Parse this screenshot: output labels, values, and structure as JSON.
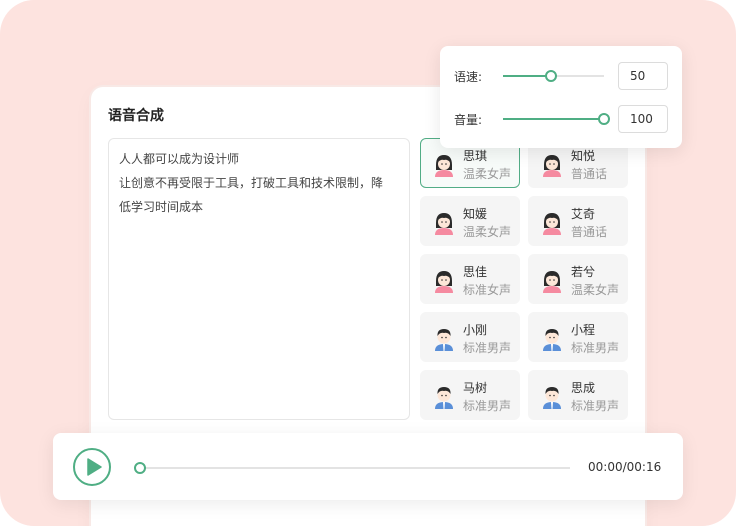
{
  "colors": {
    "accent": "#4fae84",
    "background": "#fde3df",
    "female_top": "#f58aa0",
    "male_top": "#5a8fd8"
  },
  "panel": {
    "title": "语音合成"
  },
  "editor": {
    "lines": [
      "人人都可以成为设计师",
      "让创意不再受限于工具，打破工具和技术限制，降",
      "低学习时间成本"
    ]
  },
  "voices": [
    {
      "name": "思琪",
      "desc": "温柔女声",
      "gender": "female",
      "selected": true
    },
    {
      "name": "知悦",
      "desc": "普通话",
      "gender": "female",
      "selected": false
    },
    {
      "name": "知媛",
      "desc": "温柔女声",
      "gender": "female",
      "selected": false
    },
    {
      "name": "艾奇",
      "desc": "普通话",
      "gender": "female",
      "selected": false
    },
    {
      "name": "思佳",
      "desc": "标准女声",
      "gender": "female",
      "selected": false
    },
    {
      "name": "若兮",
      "desc": "温柔女声",
      "gender": "female",
      "selected": false
    },
    {
      "name": "小刚",
      "desc": "标准男声",
      "gender": "male",
      "selected": false
    },
    {
      "name": "小程",
      "desc": "标准男声",
      "gender": "male",
      "selected": false
    },
    {
      "name": "马树",
      "desc": "标准男声",
      "gender": "male",
      "selected": false
    },
    {
      "name": "思成",
      "desc": "标准男声",
      "gender": "male",
      "selected": false
    }
  ],
  "settings": {
    "speed": {
      "label": "语速:",
      "value": "50",
      "fraction": 0.48
    },
    "volume": {
      "label": "音量:",
      "value": "100",
      "fraction": 1.0
    }
  },
  "player": {
    "time": "00:00/00:16",
    "progress": 0,
    "icon": "play-icon"
  }
}
